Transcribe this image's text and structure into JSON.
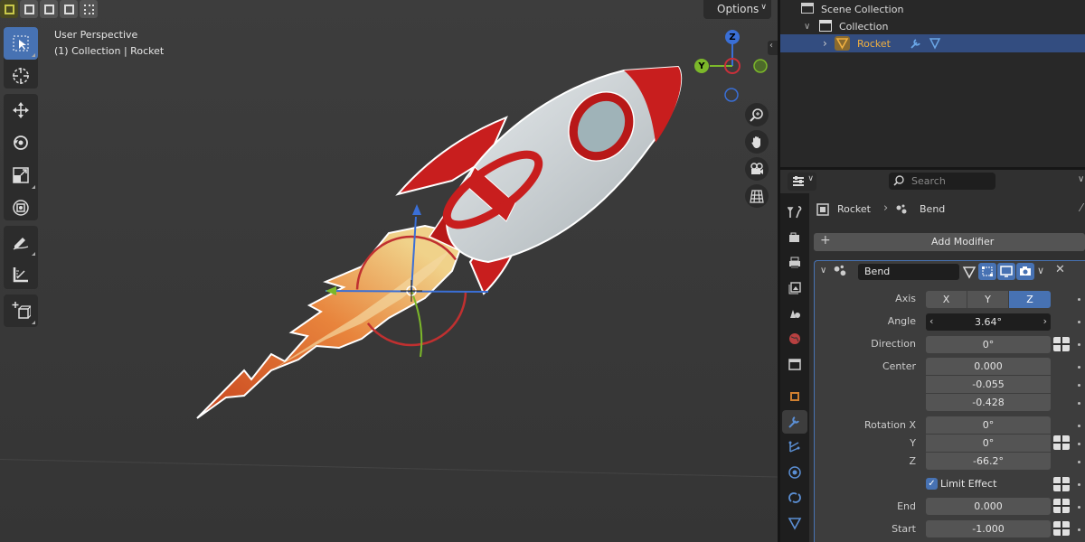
{
  "viewport": {
    "perspective_label": "User Perspective",
    "collection_label": "(1) Collection | Rocket",
    "options_label": "Options",
    "gizmo": {
      "z": "Z",
      "y": "Y"
    },
    "toolbar": [
      "select-box",
      "cursor",
      "move",
      "rotate",
      "scale",
      "transform",
      "annotate",
      "measure",
      "add-cube"
    ],
    "nav": [
      "zoom",
      "pan",
      "camera",
      "ortho"
    ]
  },
  "outliner": {
    "scene_collection": "Scene Collection",
    "collection": "Collection",
    "object": "Rocket"
  },
  "properties": {
    "search_placeholder": "Search",
    "breadcrumb_object": "Rocket",
    "breadcrumb_modifier": "Bend",
    "add_modifier": "Add Modifier",
    "modifier_name": "Bend",
    "axis_label": "Axis",
    "axis_options": [
      "X",
      "Y",
      "Z"
    ],
    "axis_selected": "Z",
    "angle_label": "Angle",
    "angle_value": "3.64°",
    "direction_label": "Direction",
    "direction_value": "0°",
    "center_label": "Center",
    "center_values": [
      "0.000",
      "-0.055",
      "-0.428"
    ],
    "rotation_x_label": "Rotation X",
    "rotation_y_label": "Y",
    "rotation_z_label": "Z",
    "rotation_values": [
      "0°",
      "0°",
      "-66.2°"
    ],
    "limit_effect_label": "Limit Effect",
    "limit_effect_checked": true,
    "end_label": "End",
    "end_value": "0.000",
    "start_label": "Start",
    "start_value": "-1.000"
  },
  "colors": {
    "accent": "#4772b3",
    "rocket_red": "#c81e1e",
    "object_orange": "#e8a33d"
  }
}
